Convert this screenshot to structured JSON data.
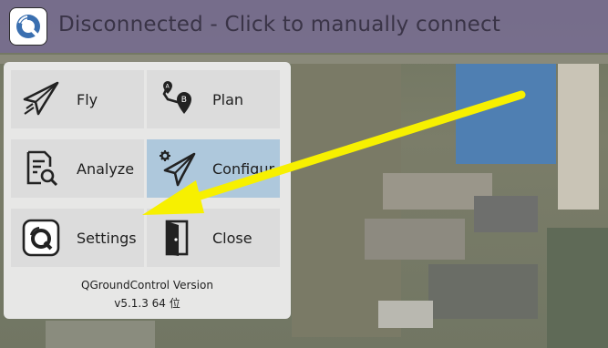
{
  "status_bar": {
    "connection_status": "Disconnected - Click to manually connect",
    "logo_icon": "qgc-logo-icon"
  },
  "tool_menu": {
    "items": [
      {
        "label": "Fly",
        "icon": "paper-plane-icon",
        "selected": false
      },
      {
        "label": "Plan",
        "icon": "route-a-b-icon",
        "selected": false
      },
      {
        "label": "Analyze",
        "icon": "document-search-icon",
        "selected": false
      },
      {
        "label": "Configur",
        "icon": "gear-paper-plane-icon",
        "selected": true
      },
      {
        "label": "Settings",
        "icon": "qgc-logo-icon",
        "selected": false
      },
      {
        "label": "Close",
        "icon": "door-icon",
        "selected": false
      }
    ],
    "version_title": "QGroundControl Version",
    "version_number": "v5.1.3 64 位"
  },
  "colors": {
    "topbar": "#786c96",
    "panel": "#eeeeee",
    "tile": "#dcdcdc",
    "tile_selected": "#aec8dc",
    "annotation_arrow": "#f7f000"
  }
}
